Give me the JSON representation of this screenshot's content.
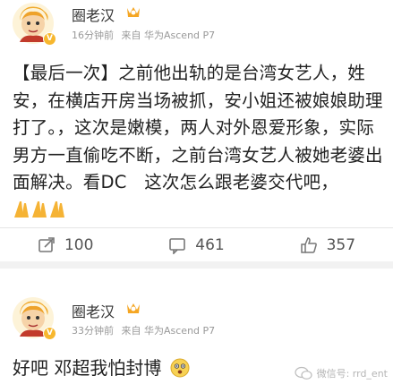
{
  "post1": {
    "username": "圈老汉",
    "time": "16分钟前",
    "source": "来自 华为Ascend P7",
    "content": "【最后一次】之前他出轨的是台湾女艺人，姓安，在横店开房当场被抓，安小姐还被娘娘助理打了。，这次是嫩模，两人对外恩爱形象，实际男方一直偷吃不断，之前台湾女艺人被她老婆出面解决。看DC　这次怎么跟老婆交代吧，",
    "repost_count": "100",
    "comment_count": "461",
    "like_count": "357"
  },
  "post2": {
    "username": "圈老汉",
    "time": "33分钟前",
    "source": "来自 华为Ascend P7",
    "content": "好吧 邓超我怕封博"
  },
  "watermark": "微信号: rrd_ent",
  "colors": {
    "vip_orange": "#f7b72e",
    "text": "#222222",
    "meta": "#999999"
  }
}
